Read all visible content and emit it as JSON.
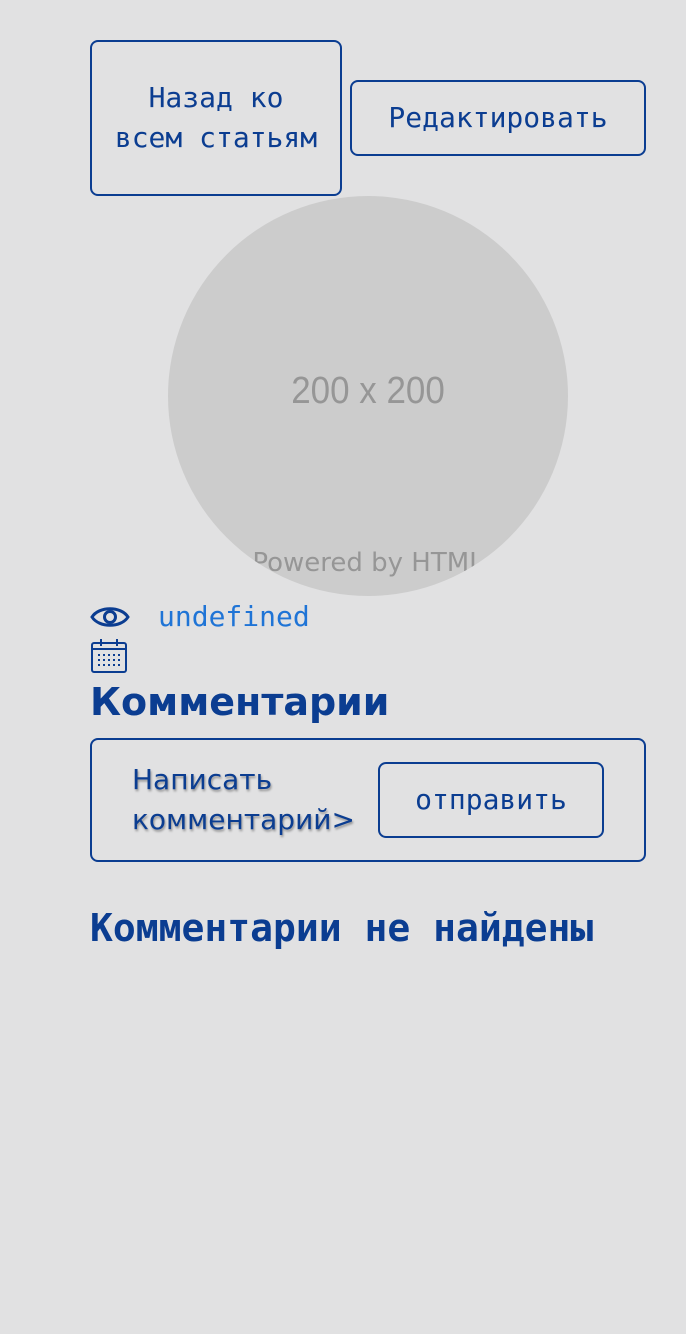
{
  "header": {
    "back_label": "Назад ко всем статьям",
    "edit_label": "Редактировать"
  },
  "image": {
    "size_text": "200 x 200",
    "powered_text": "Powered by HTML"
  },
  "stats": {
    "views_icon": "eye-icon",
    "views_value": "undefined",
    "date_icon": "calendar-icon"
  },
  "comments": {
    "title": "Комментарии",
    "input_placeholder": "Написать комментарий>",
    "send_label": "отправить",
    "empty_text": "Комментарии не найдены"
  },
  "colors": {
    "background": "#e1e1e2",
    "primary": "#0b3d91",
    "link": "#1f74d6",
    "image_placeholder": "#cccccc"
  }
}
